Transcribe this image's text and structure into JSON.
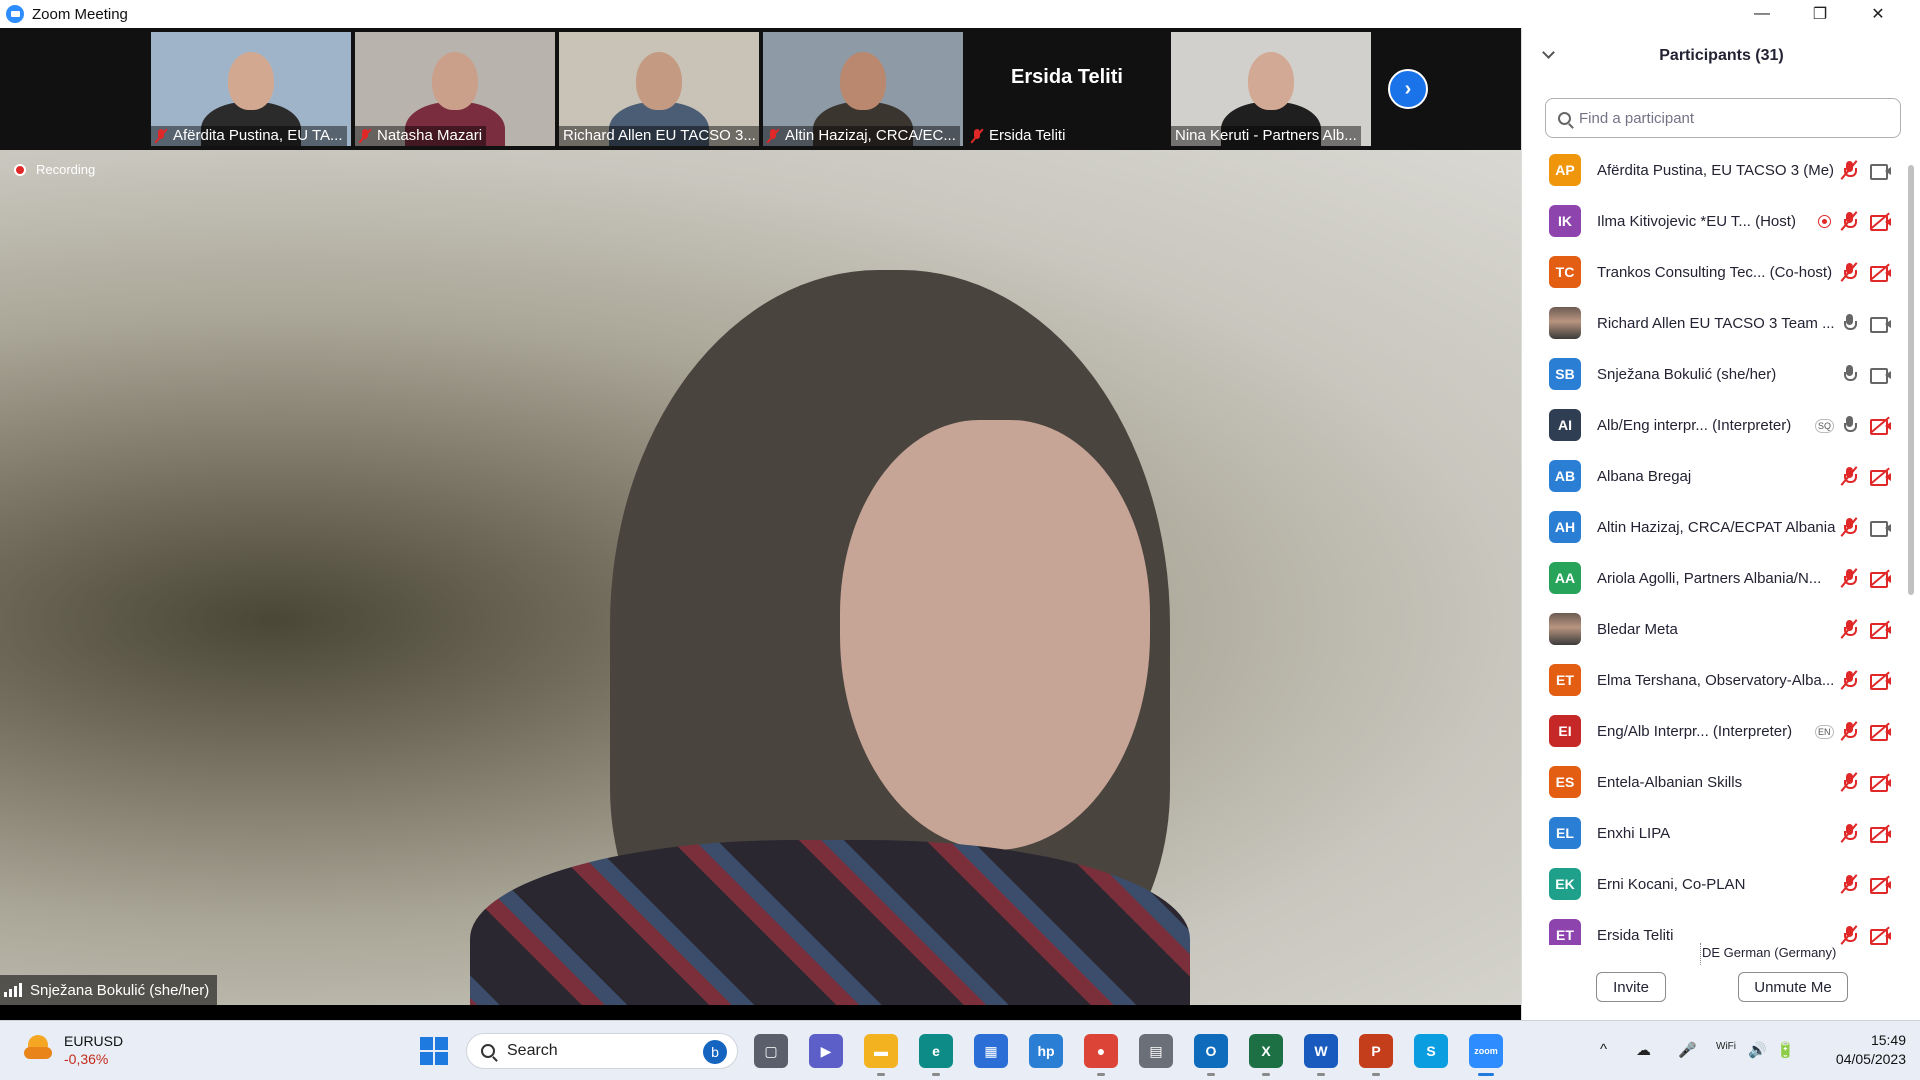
{
  "window": {
    "title": "Zoom Meeting",
    "minimize": "—",
    "restore": "❐",
    "close": "✕"
  },
  "thumbnails": [
    {
      "name": "Afërdita Pustina, EU TA...",
      "muted": true
    },
    {
      "name": "Natasha Mazari",
      "muted": true
    },
    {
      "name": "Richard Allen EU TACSO 3...",
      "muted": false
    },
    {
      "name": "Altin Hazizaj, CRCA/EC...",
      "muted": true
    },
    {
      "name": "Ersida Teliti",
      "muted": true,
      "video_off_label": "Ersida Teliti"
    },
    {
      "name": "Nina Keruti - Partners Alb...",
      "muted": false
    }
  ],
  "thumb_next": "›",
  "recording": {
    "label": "Recording"
  },
  "active_speaker": {
    "name": "Snježana Bokulić (she/her)"
  },
  "participants_panel": {
    "title": "Participants (31)",
    "search_placeholder": "Find a participant",
    "participants": [
      {
        "initials": "AP",
        "color": "#f0960c",
        "name": "Afërdita Pustina, EU TACSO 3 (Me)",
        "mic_muted": true,
        "video_on": true,
        "tag": "",
        "recording": false,
        "photo": false
      },
      {
        "initials": "IK",
        "color": "#8e44ad",
        "name": "Ilma Kitivojevic *EU T...   (Host)",
        "mic_muted": true,
        "video_on": false,
        "tag": "",
        "recording": true,
        "photo": false
      },
      {
        "initials": "TC",
        "color": "#e35d12",
        "name": "Trankos Consulting Tec... (Co-host)",
        "mic_muted": true,
        "video_on": false,
        "tag": "",
        "recording": false,
        "photo": false
      },
      {
        "initials": "",
        "color": "#6c5b52",
        "name": "Richard Allen EU TACSO 3 Team ...",
        "mic_muted": false,
        "video_on": true,
        "tag": "",
        "recording": false,
        "photo": true
      },
      {
        "initials": "SB",
        "color": "#2a7fd4",
        "name": "Snježana Bokulić (she/her)",
        "mic_muted": false,
        "video_on": true,
        "tag": "",
        "recording": false,
        "photo": false
      },
      {
        "initials": "AI",
        "color": "#2f3e52",
        "name": "Alb/Eng interpr...   (Interpreter)",
        "mic_muted": false,
        "video_on": false,
        "tag": "SQ",
        "recording": false,
        "photo": false
      },
      {
        "initials": "AB",
        "color": "#2a7fd4",
        "name": "Albana Bregaj",
        "mic_muted": true,
        "video_on": false,
        "tag": "",
        "recording": false,
        "photo": false
      },
      {
        "initials": "AH",
        "color": "#2a7fd4",
        "name": "Altin Hazizaj, CRCA/ECPAT Albania",
        "mic_muted": true,
        "video_on": true,
        "tag": "",
        "recording": false,
        "photo": false
      },
      {
        "initials": "AA",
        "color": "#27a35a",
        "name": "Ariola Agolli, Partners Albania/N...",
        "mic_muted": true,
        "video_on": false,
        "tag": "",
        "recording": false,
        "photo": false
      },
      {
        "initials": "",
        "color": "#3b3b3b",
        "name": "Bledar Meta",
        "mic_muted": true,
        "video_on": false,
        "tag": "",
        "recording": false,
        "photo": true
      },
      {
        "initials": "ET",
        "color": "#e35d12",
        "name": "Elma Tershana, Observatory-Alba...",
        "mic_muted": true,
        "video_on": false,
        "tag": "",
        "recording": false,
        "photo": false
      },
      {
        "initials": "EI",
        "color": "#c62828",
        "name": "Eng/Alb Interpr...   (Interpreter)",
        "mic_muted": true,
        "video_on": false,
        "tag": "EN",
        "recording": false,
        "photo": false
      },
      {
        "initials": "ES",
        "color": "#e35d12",
        "name": "Entela-Albanian Skills",
        "mic_muted": true,
        "video_on": false,
        "tag": "",
        "recording": false,
        "photo": false
      },
      {
        "initials": "EL",
        "color": "#2a7fd4",
        "name": "Enxhi LIPA",
        "mic_muted": true,
        "video_on": false,
        "tag": "",
        "recording": false,
        "photo": false
      },
      {
        "initials": "EK",
        "color": "#1fa08a",
        "name": "Erni Kocani, Co-PLAN",
        "mic_muted": true,
        "video_on": false,
        "tag": "",
        "recording": false,
        "photo": false
      },
      {
        "initials": "ET",
        "color": "#8e44ad",
        "name": "Ersida Teliti",
        "mic_muted": true,
        "video_on": false,
        "tag": "",
        "recording": false,
        "photo": false
      }
    ],
    "language": "DE German (Germany)",
    "invite_label": "Invite",
    "unmute_label": "Unmute Me"
  },
  "taskbar": {
    "ticker_symbol": "EURUSD",
    "ticker_change": "-0,36%",
    "search_label": "Search",
    "apps": [
      {
        "name": "task-view",
        "glyph": "▢",
        "color": "#5a5f6b"
      },
      {
        "name": "teams-chat",
        "glyph": "▶",
        "color": "#5b5fc7"
      },
      {
        "name": "file-explorer",
        "glyph": "▬",
        "color": "#f3b320"
      },
      {
        "name": "edge",
        "glyph": "e",
        "color": "#0c8b87"
      },
      {
        "name": "store",
        "glyph": "▦",
        "color": "#2b6fd6"
      },
      {
        "name": "myhp",
        "glyph": "hp",
        "color": "#2a7fd4"
      },
      {
        "name": "chrome",
        "glyph": "●",
        "color": "#db4437"
      },
      {
        "name": "calculator",
        "glyph": "▤",
        "color": "#6b6f78"
      },
      {
        "name": "outlook",
        "glyph": "O",
        "color": "#0f6cbd"
      },
      {
        "name": "excel",
        "glyph": "X",
        "color": "#1d7044"
      },
      {
        "name": "word",
        "glyph": "W",
        "color": "#185abd"
      },
      {
        "name": "powerpoint",
        "glyph": "P",
        "color": "#c43e1c"
      },
      {
        "name": "skype",
        "glyph": "S",
        "color": "#0a9ee0"
      },
      {
        "name": "zoom",
        "glyph": "zoom",
        "color": "#2d8cff"
      }
    ],
    "tray_glyphs": [
      "^",
      "☁",
      "🎤",
      "WiFi",
      "🔊",
      "🔋"
    ],
    "time": "15:49",
    "date": "04/05/2023"
  }
}
